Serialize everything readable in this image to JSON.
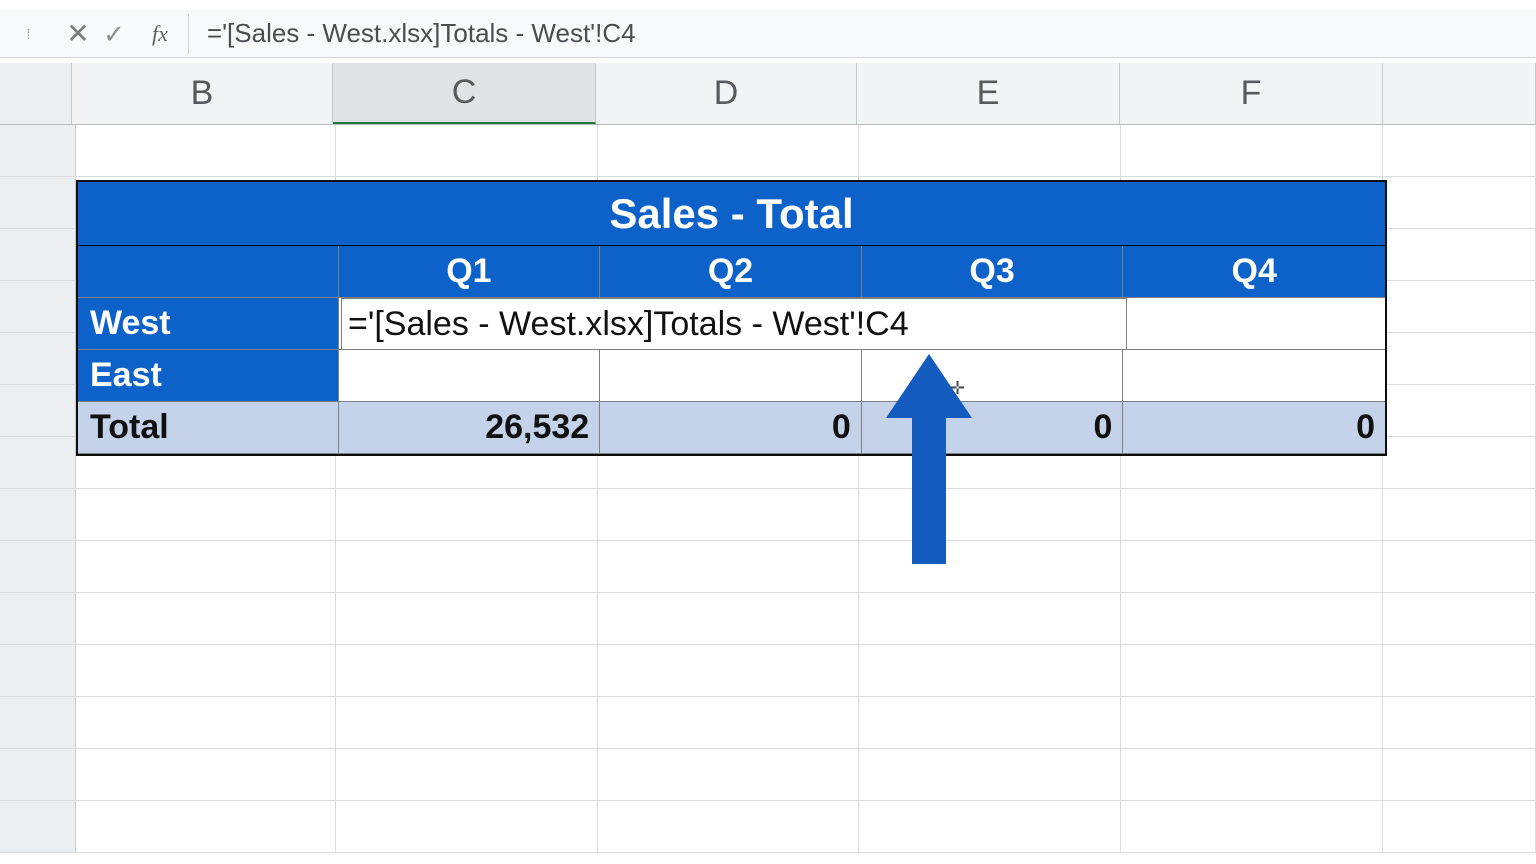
{
  "formula_bar": {
    "formula": "='[Sales - West.xlsx]Totals - West'!C4",
    "cancel_glyph": "✕",
    "confirm_glyph": "✓",
    "fx_label": "fx"
  },
  "columns": {
    "B": "B",
    "C": "C",
    "D": "D",
    "E": "E",
    "F": "F"
  },
  "table": {
    "title": "Sales - Total",
    "headers": {
      "q1": "Q1",
      "q2": "Q2",
      "q3": "Q3",
      "q4": "Q4"
    },
    "rows": {
      "west_label": "West",
      "east_label": "East",
      "total_label": "Total"
    },
    "editing_formula": "='[Sales - West.xlsx]Totals - West'!C4",
    "totals": {
      "q1": "26,532",
      "q2": "0",
      "q3": "0",
      "q4": "0"
    }
  },
  "annotation": {
    "arrow_color": "#135bbf",
    "cursor_glyph": "✛"
  }
}
